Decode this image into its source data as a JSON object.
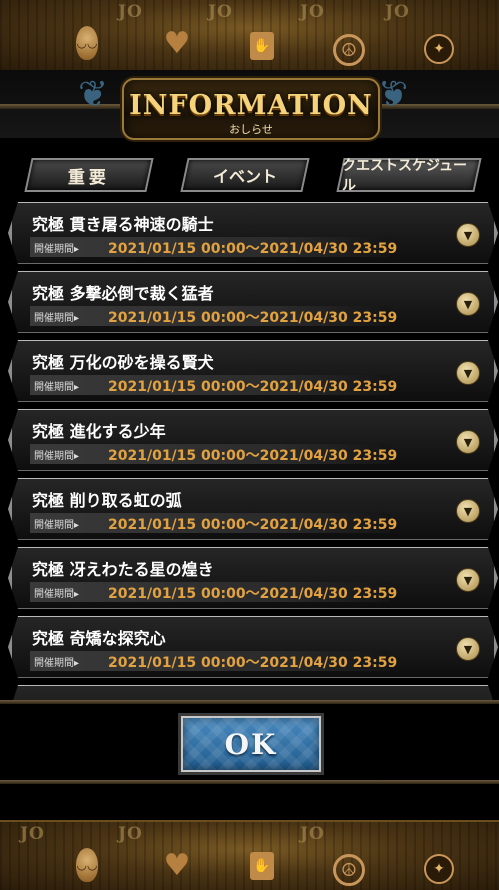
{
  "header": {
    "title": "INFORMATION",
    "subtitle": "おしらせ",
    "logo_text": "JO"
  },
  "tabs": [
    {
      "label": "重要"
    },
    {
      "label": "イベント"
    },
    {
      "label": "クエストスケジュール"
    }
  ],
  "list": {
    "period_label": "開催期間▸",
    "items": [
      {
        "title": "究極 貫き屠る神速の騎士",
        "period": "2021/01/15 00:00〜2021/04/30 23:59"
      },
      {
        "title": "究極 多撃必倒で裁く猛者",
        "period": "2021/01/15 00:00〜2021/04/30 23:59"
      },
      {
        "title": "究極 万化の砂を操る賢犬",
        "period": "2021/01/15 00:00〜2021/04/30 23:59"
      },
      {
        "title": "究極 進化する少年",
        "period": "2021/01/15 00:00〜2021/04/30 23:59"
      },
      {
        "title": "究極 削り取る虹の弧",
        "period": "2021/01/15 00:00〜2021/04/30 23:59"
      },
      {
        "title": "究極 冴えわたる星の煌き",
        "period": "2021/01/15 00:00〜2021/04/30 23:59"
      },
      {
        "title": "究極 奇矯な探究心",
        "period": "2021/01/15 00:00〜2021/04/30 23:59"
      }
    ]
  },
  "ok_button": {
    "label": "OK"
  },
  "colors": {
    "accent": "#e2a240",
    "title_gold": "#f5d37a",
    "ok_blue": "#3a7ab0"
  }
}
